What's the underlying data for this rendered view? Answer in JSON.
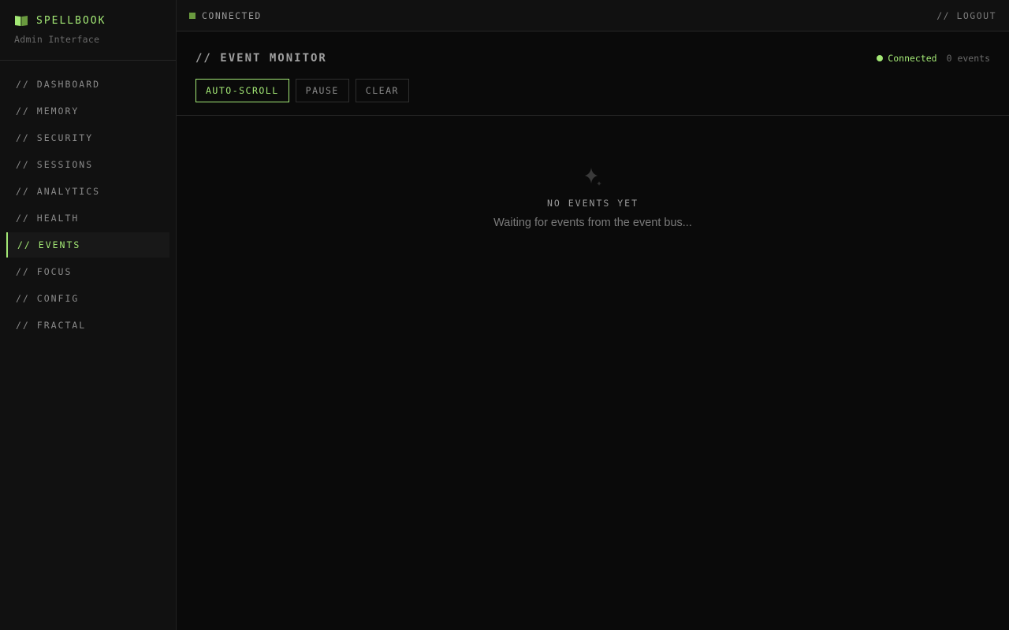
{
  "brand": {
    "title": "SPELLBOOK",
    "subtitle": "Admin Interface",
    "icon": "book-icon",
    "accent": "#a3e875"
  },
  "sidebar": {
    "items": [
      {
        "label": "// DASHBOARD"
      },
      {
        "label": "// MEMORY"
      },
      {
        "label": "// SECURITY"
      },
      {
        "label": "// SESSIONS"
      },
      {
        "label": "// ANALYTICS"
      },
      {
        "label": "// HEALTH"
      },
      {
        "label": "// EVENTS",
        "active": true
      },
      {
        "label": "// FOCUS"
      },
      {
        "label": "// CONFIG"
      },
      {
        "label": "// FRACTAL"
      }
    ]
  },
  "topbar": {
    "connection_label": "CONNECTED",
    "logout_label": "// LOGOUT"
  },
  "monitor": {
    "title": "// EVENT MONITOR",
    "status_text": "Connected",
    "event_count": "0 events",
    "buttons": {
      "auto_scroll": "AUTO-SCROLL",
      "pause": "PAUSE",
      "clear": "CLEAR"
    },
    "auto_scroll_active": true
  },
  "empty_state": {
    "icon": "sparkle-icon",
    "title": "NO EVENTS YET",
    "subtitle": "Waiting for events from the event bus..."
  }
}
